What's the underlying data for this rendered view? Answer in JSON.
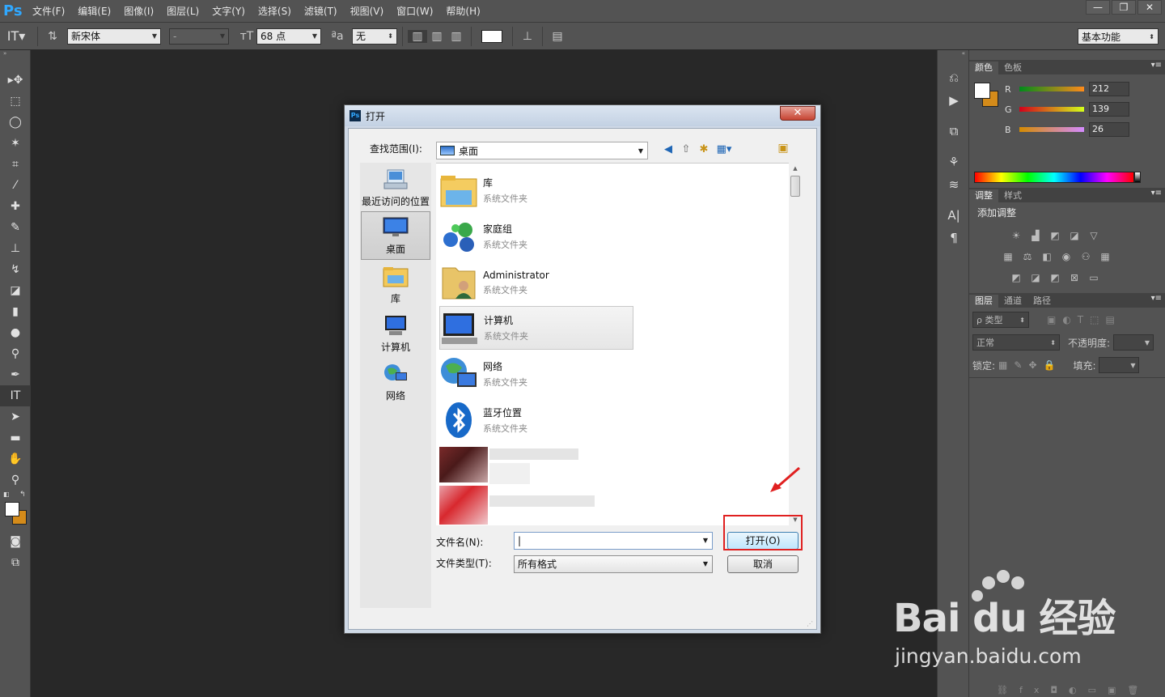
{
  "app": {
    "logo": "Ps"
  },
  "menu": [
    "文件(F)",
    "编辑(E)",
    "图像(I)",
    "图层(L)",
    "文字(Y)",
    "选择(S)",
    "滤镜(T)",
    "视图(V)",
    "窗口(W)",
    "帮助(H)"
  ],
  "window_controls": {
    "minimize": "—",
    "restore": "❐",
    "close": "✕"
  },
  "options": {
    "font_family": "新宋体",
    "font_style": "-",
    "font_size": "68 点",
    "anti_alias": "无",
    "workspace": "基本功能"
  },
  "panels": {
    "color": {
      "tabs": [
        "颜色",
        "色板"
      ],
      "r_label": "R",
      "g_label": "G",
      "b_label": "B",
      "r": "212",
      "g": "139",
      "b": "26"
    },
    "adjust": {
      "tabs": [
        "调整",
        "样式"
      ],
      "title": "添加调整"
    },
    "layers": {
      "tabs": [
        "图层",
        "通道",
        "路径"
      ],
      "filter": "ρ 类型",
      "blend": "正常",
      "opacity_label": "不透明度:",
      "lock_label": "锁定:",
      "fill_label": "填充:"
    }
  },
  "dialog": {
    "title": "打开",
    "close": "✕",
    "look_in_label": "查找范围(I):",
    "look_in_value": "桌面",
    "places": [
      {
        "label": "最近访问的位置"
      },
      {
        "label": "桌面"
      },
      {
        "label": "库"
      },
      {
        "label": "计算机"
      },
      {
        "label": "网络"
      }
    ],
    "files": [
      {
        "name": "库",
        "desc": "系统文件夹"
      },
      {
        "name": "家庭组",
        "desc": "系统文件夹"
      },
      {
        "name": "Administrator",
        "desc": "系统文件夹"
      },
      {
        "name": "计算机",
        "desc": "系统文件夹"
      },
      {
        "name": "网络",
        "desc": "系统文件夹"
      },
      {
        "name": "蓝牙位置",
        "desc": "系统文件夹"
      }
    ],
    "filename_label": "文件名(N):",
    "filename_value": "",
    "filetype_label": "文件类型(T):",
    "filetype_value": "所有格式",
    "open_button": "打开(O)",
    "cancel_button": "取消"
  },
  "watermark": {
    "brand": "Bai du 经验",
    "url": "jingyan.baidu.com"
  },
  "colors": {
    "accent_red": "#e02020",
    "bg_swatch": "#d48b1a",
    "ps_blue": "#30a8ff"
  }
}
